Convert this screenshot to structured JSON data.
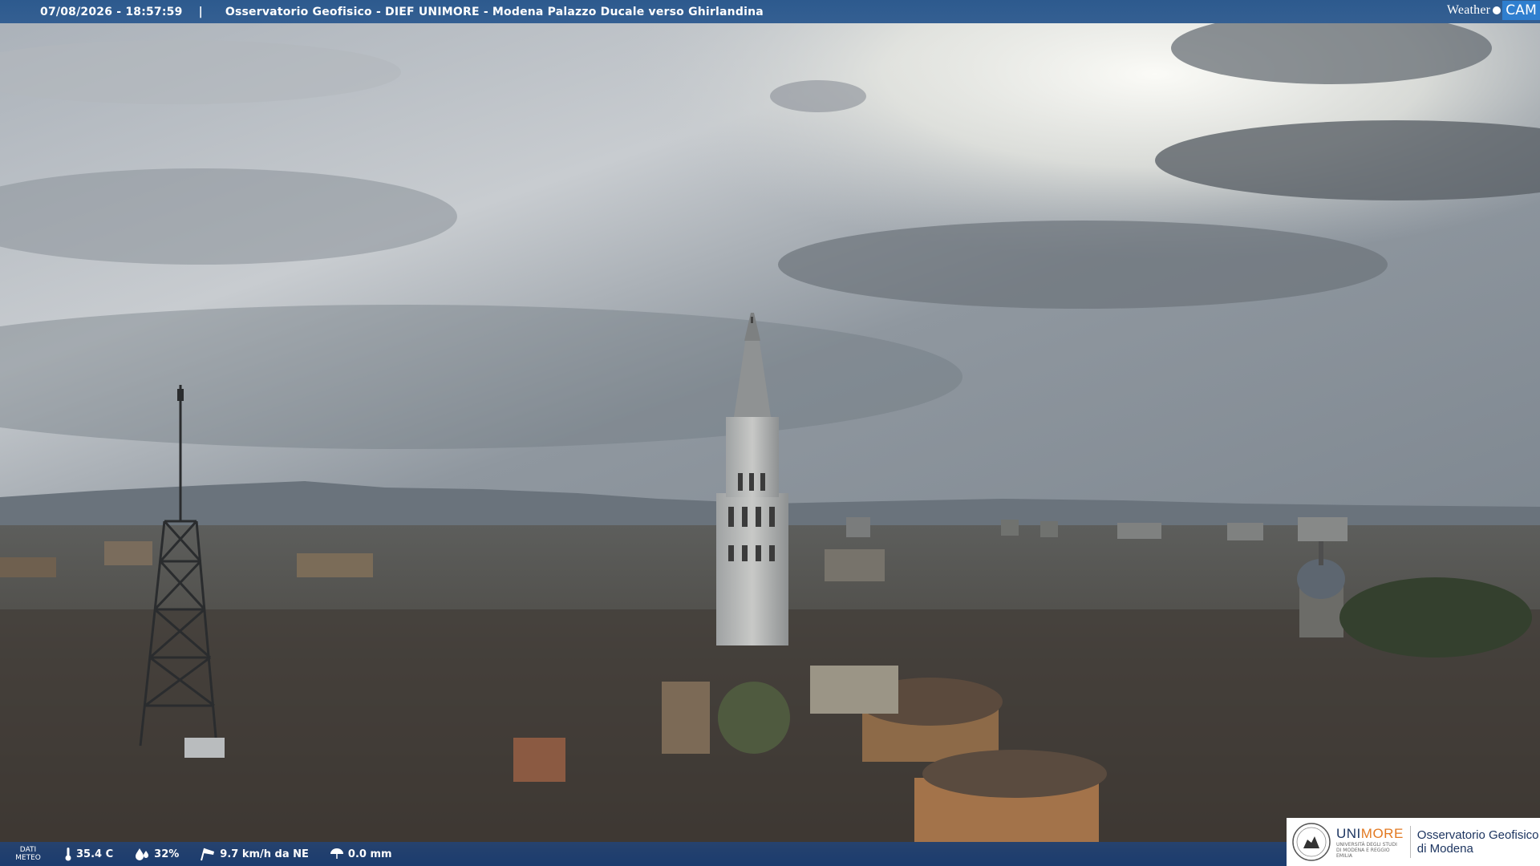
{
  "header": {
    "datetime": "07/08/2026 - 18:57:59",
    "separator": "|",
    "location": "Osservatorio Geofisico - DIEF UNIMORE - Modena Palazzo Ducale verso Ghirlandina"
  },
  "brand": {
    "weather": "Weather",
    "cam": "CAM"
  },
  "meteo": {
    "label_line1": "DATI",
    "label_line2": "METEO",
    "temperature": "35.4 C",
    "humidity": "32%",
    "wind": "9.7 km/h da NE",
    "rain": "0.0 mm"
  },
  "logo": {
    "uni_prefix": "UNI",
    "uni_suffix": "MORE",
    "uni_sub": "UNIVERSITÀ DEGLI STUDI DI MODENA E REGGIO EMILIA",
    "observatory_line1": "Osservatorio Geofisico",
    "observatory_line2": "di Modena"
  },
  "colors": {
    "bar": "#2d5a8e",
    "accent": "#e27921",
    "brand_blue": "#1d3560"
  }
}
